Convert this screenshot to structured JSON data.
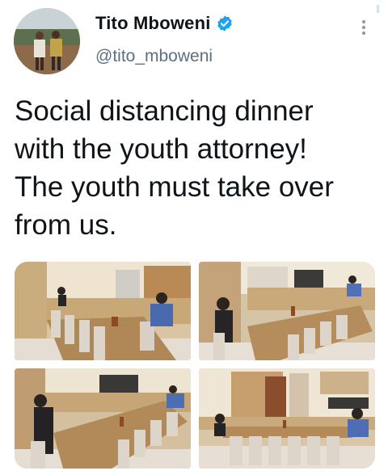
{
  "author": {
    "display_name": "Tito Mboweni",
    "handle": "@tito_mboweni",
    "verified": true,
    "avatar_icon": "profile-photo"
  },
  "tweet": {
    "text": "Social distancing dinner\nwith the youth attorney!\nThe youth must take over\nfrom us."
  },
  "media": {
    "count": 4,
    "photos": [
      "dining-room-photo",
      "dining-room-photo",
      "dining-room-photo",
      "dining-room-photo"
    ]
  },
  "colors": {
    "text": "#0f1419",
    "secondary": "#5b7083",
    "verified_badge": "#1da1f2"
  }
}
